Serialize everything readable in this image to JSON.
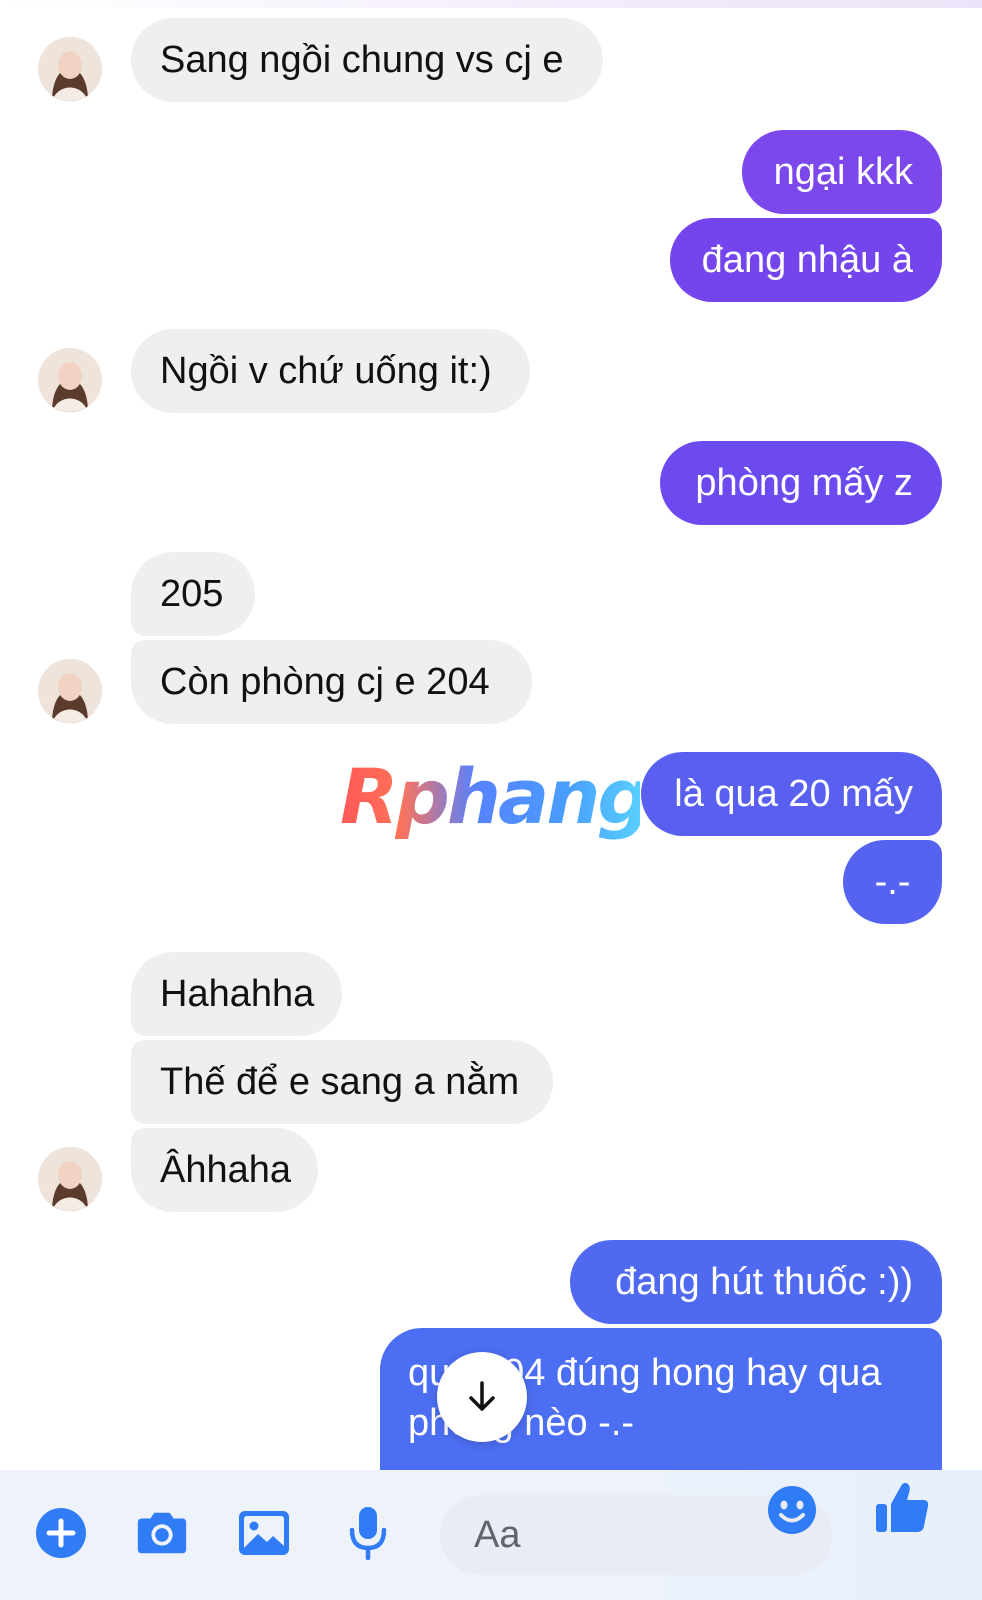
{
  "watermark": "Rphang",
  "messages": [
    {
      "from": "them",
      "text": "Sang ngồi chung vs cj e"
    },
    {
      "from": "me",
      "text": "ngại kkk"
    },
    {
      "from": "me",
      "text": "đang nhậu à"
    },
    {
      "from": "them",
      "text": "Ngồi v chứ uống it:)"
    },
    {
      "from": "me",
      "text": "phòng mấy z"
    },
    {
      "from": "them",
      "text": "205"
    },
    {
      "from": "them",
      "text": "Còn phòng cj e 204"
    },
    {
      "from": "me",
      "text": "là qua 20 mấy"
    },
    {
      "from": "me",
      "text": "-.-"
    },
    {
      "from": "them",
      "text": "Hahahha"
    },
    {
      "from": "them",
      "text": "Thế để e sang a nằm"
    },
    {
      "from": "them",
      "text": "Âhhaha"
    },
    {
      "from": "me",
      "text": "đang hút thuốc :))"
    },
    {
      "from": "me",
      "text_line1": "qua 204 đúng hong hay qua",
      "text_line2": "phòng nèo -.-"
    }
  ],
  "composer": {
    "placeholder": "Aa",
    "icons": [
      "plus-icon",
      "camera-icon",
      "image-icon",
      "microphone-icon",
      "emoji-icon",
      "thumbs-up-icon"
    ]
  },
  "colors": {
    "incoming_bubble": "#efefef",
    "outgoing_purple": "#7c48ec",
    "outgoing_blue": "#4d6cf1",
    "accent_icon": "#2f7cf6"
  }
}
